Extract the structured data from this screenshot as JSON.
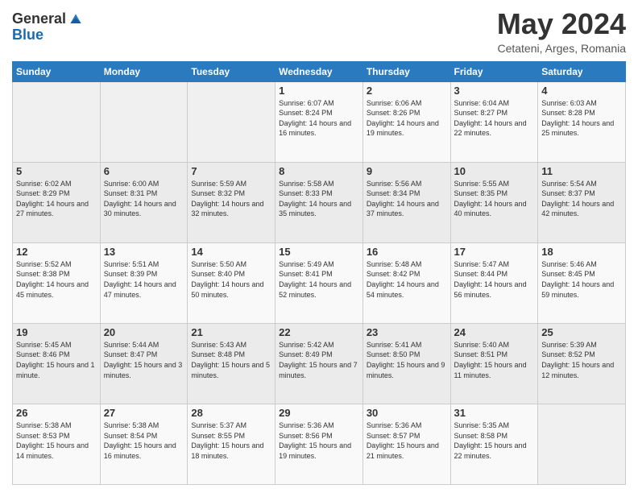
{
  "header": {
    "logo_general": "General",
    "logo_blue": "Blue",
    "title": "May 2024",
    "subtitle": "Cetateni, Arges, Romania"
  },
  "days_of_week": [
    "Sunday",
    "Monday",
    "Tuesday",
    "Wednesday",
    "Thursday",
    "Friday",
    "Saturday"
  ],
  "weeks": [
    [
      {
        "day": "",
        "info": ""
      },
      {
        "day": "",
        "info": ""
      },
      {
        "day": "",
        "info": ""
      },
      {
        "day": "1",
        "info": "Sunrise: 6:07 AM\nSunset: 8:24 PM\nDaylight: 14 hours and 16 minutes."
      },
      {
        "day": "2",
        "info": "Sunrise: 6:06 AM\nSunset: 8:26 PM\nDaylight: 14 hours and 19 minutes."
      },
      {
        "day": "3",
        "info": "Sunrise: 6:04 AM\nSunset: 8:27 PM\nDaylight: 14 hours and 22 minutes."
      },
      {
        "day": "4",
        "info": "Sunrise: 6:03 AM\nSunset: 8:28 PM\nDaylight: 14 hours and 25 minutes."
      }
    ],
    [
      {
        "day": "5",
        "info": "Sunrise: 6:02 AM\nSunset: 8:29 PM\nDaylight: 14 hours and 27 minutes."
      },
      {
        "day": "6",
        "info": "Sunrise: 6:00 AM\nSunset: 8:31 PM\nDaylight: 14 hours and 30 minutes."
      },
      {
        "day": "7",
        "info": "Sunrise: 5:59 AM\nSunset: 8:32 PM\nDaylight: 14 hours and 32 minutes."
      },
      {
        "day": "8",
        "info": "Sunrise: 5:58 AM\nSunset: 8:33 PM\nDaylight: 14 hours and 35 minutes."
      },
      {
        "day": "9",
        "info": "Sunrise: 5:56 AM\nSunset: 8:34 PM\nDaylight: 14 hours and 37 minutes."
      },
      {
        "day": "10",
        "info": "Sunrise: 5:55 AM\nSunset: 8:35 PM\nDaylight: 14 hours and 40 minutes."
      },
      {
        "day": "11",
        "info": "Sunrise: 5:54 AM\nSunset: 8:37 PM\nDaylight: 14 hours and 42 minutes."
      }
    ],
    [
      {
        "day": "12",
        "info": "Sunrise: 5:52 AM\nSunset: 8:38 PM\nDaylight: 14 hours and 45 minutes."
      },
      {
        "day": "13",
        "info": "Sunrise: 5:51 AM\nSunset: 8:39 PM\nDaylight: 14 hours and 47 minutes."
      },
      {
        "day": "14",
        "info": "Sunrise: 5:50 AM\nSunset: 8:40 PM\nDaylight: 14 hours and 50 minutes."
      },
      {
        "day": "15",
        "info": "Sunrise: 5:49 AM\nSunset: 8:41 PM\nDaylight: 14 hours and 52 minutes."
      },
      {
        "day": "16",
        "info": "Sunrise: 5:48 AM\nSunset: 8:42 PM\nDaylight: 14 hours and 54 minutes."
      },
      {
        "day": "17",
        "info": "Sunrise: 5:47 AM\nSunset: 8:44 PM\nDaylight: 14 hours and 56 minutes."
      },
      {
        "day": "18",
        "info": "Sunrise: 5:46 AM\nSunset: 8:45 PM\nDaylight: 14 hours and 59 minutes."
      }
    ],
    [
      {
        "day": "19",
        "info": "Sunrise: 5:45 AM\nSunset: 8:46 PM\nDaylight: 15 hours and 1 minute."
      },
      {
        "day": "20",
        "info": "Sunrise: 5:44 AM\nSunset: 8:47 PM\nDaylight: 15 hours and 3 minutes."
      },
      {
        "day": "21",
        "info": "Sunrise: 5:43 AM\nSunset: 8:48 PM\nDaylight: 15 hours and 5 minutes."
      },
      {
        "day": "22",
        "info": "Sunrise: 5:42 AM\nSunset: 8:49 PM\nDaylight: 15 hours and 7 minutes."
      },
      {
        "day": "23",
        "info": "Sunrise: 5:41 AM\nSunset: 8:50 PM\nDaylight: 15 hours and 9 minutes."
      },
      {
        "day": "24",
        "info": "Sunrise: 5:40 AM\nSunset: 8:51 PM\nDaylight: 15 hours and 11 minutes."
      },
      {
        "day": "25",
        "info": "Sunrise: 5:39 AM\nSunset: 8:52 PM\nDaylight: 15 hours and 12 minutes."
      }
    ],
    [
      {
        "day": "26",
        "info": "Sunrise: 5:38 AM\nSunset: 8:53 PM\nDaylight: 15 hours and 14 minutes."
      },
      {
        "day": "27",
        "info": "Sunrise: 5:38 AM\nSunset: 8:54 PM\nDaylight: 15 hours and 16 minutes."
      },
      {
        "day": "28",
        "info": "Sunrise: 5:37 AM\nSunset: 8:55 PM\nDaylight: 15 hours and 18 minutes."
      },
      {
        "day": "29",
        "info": "Sunrise: 5:36 AM\nSunset: 8:56 PM\nDaylight: 15 hours and 19 minutes."
      },
      {
        "day": "30",
        "info": "Sunrise: 5:36 AM\nSunset: 8:57 PM\nDaylight: 15 hours and 21 minutes."
      },
      {
        "day": "31",
        "info": "Sunrise: 5:35 AM\nSunset: 8:58 PM\nDaylight: 15 hours and 22 minutes."
      },
      {
        "day": "",
        "info": ""
      }
    ]
  ]
}
